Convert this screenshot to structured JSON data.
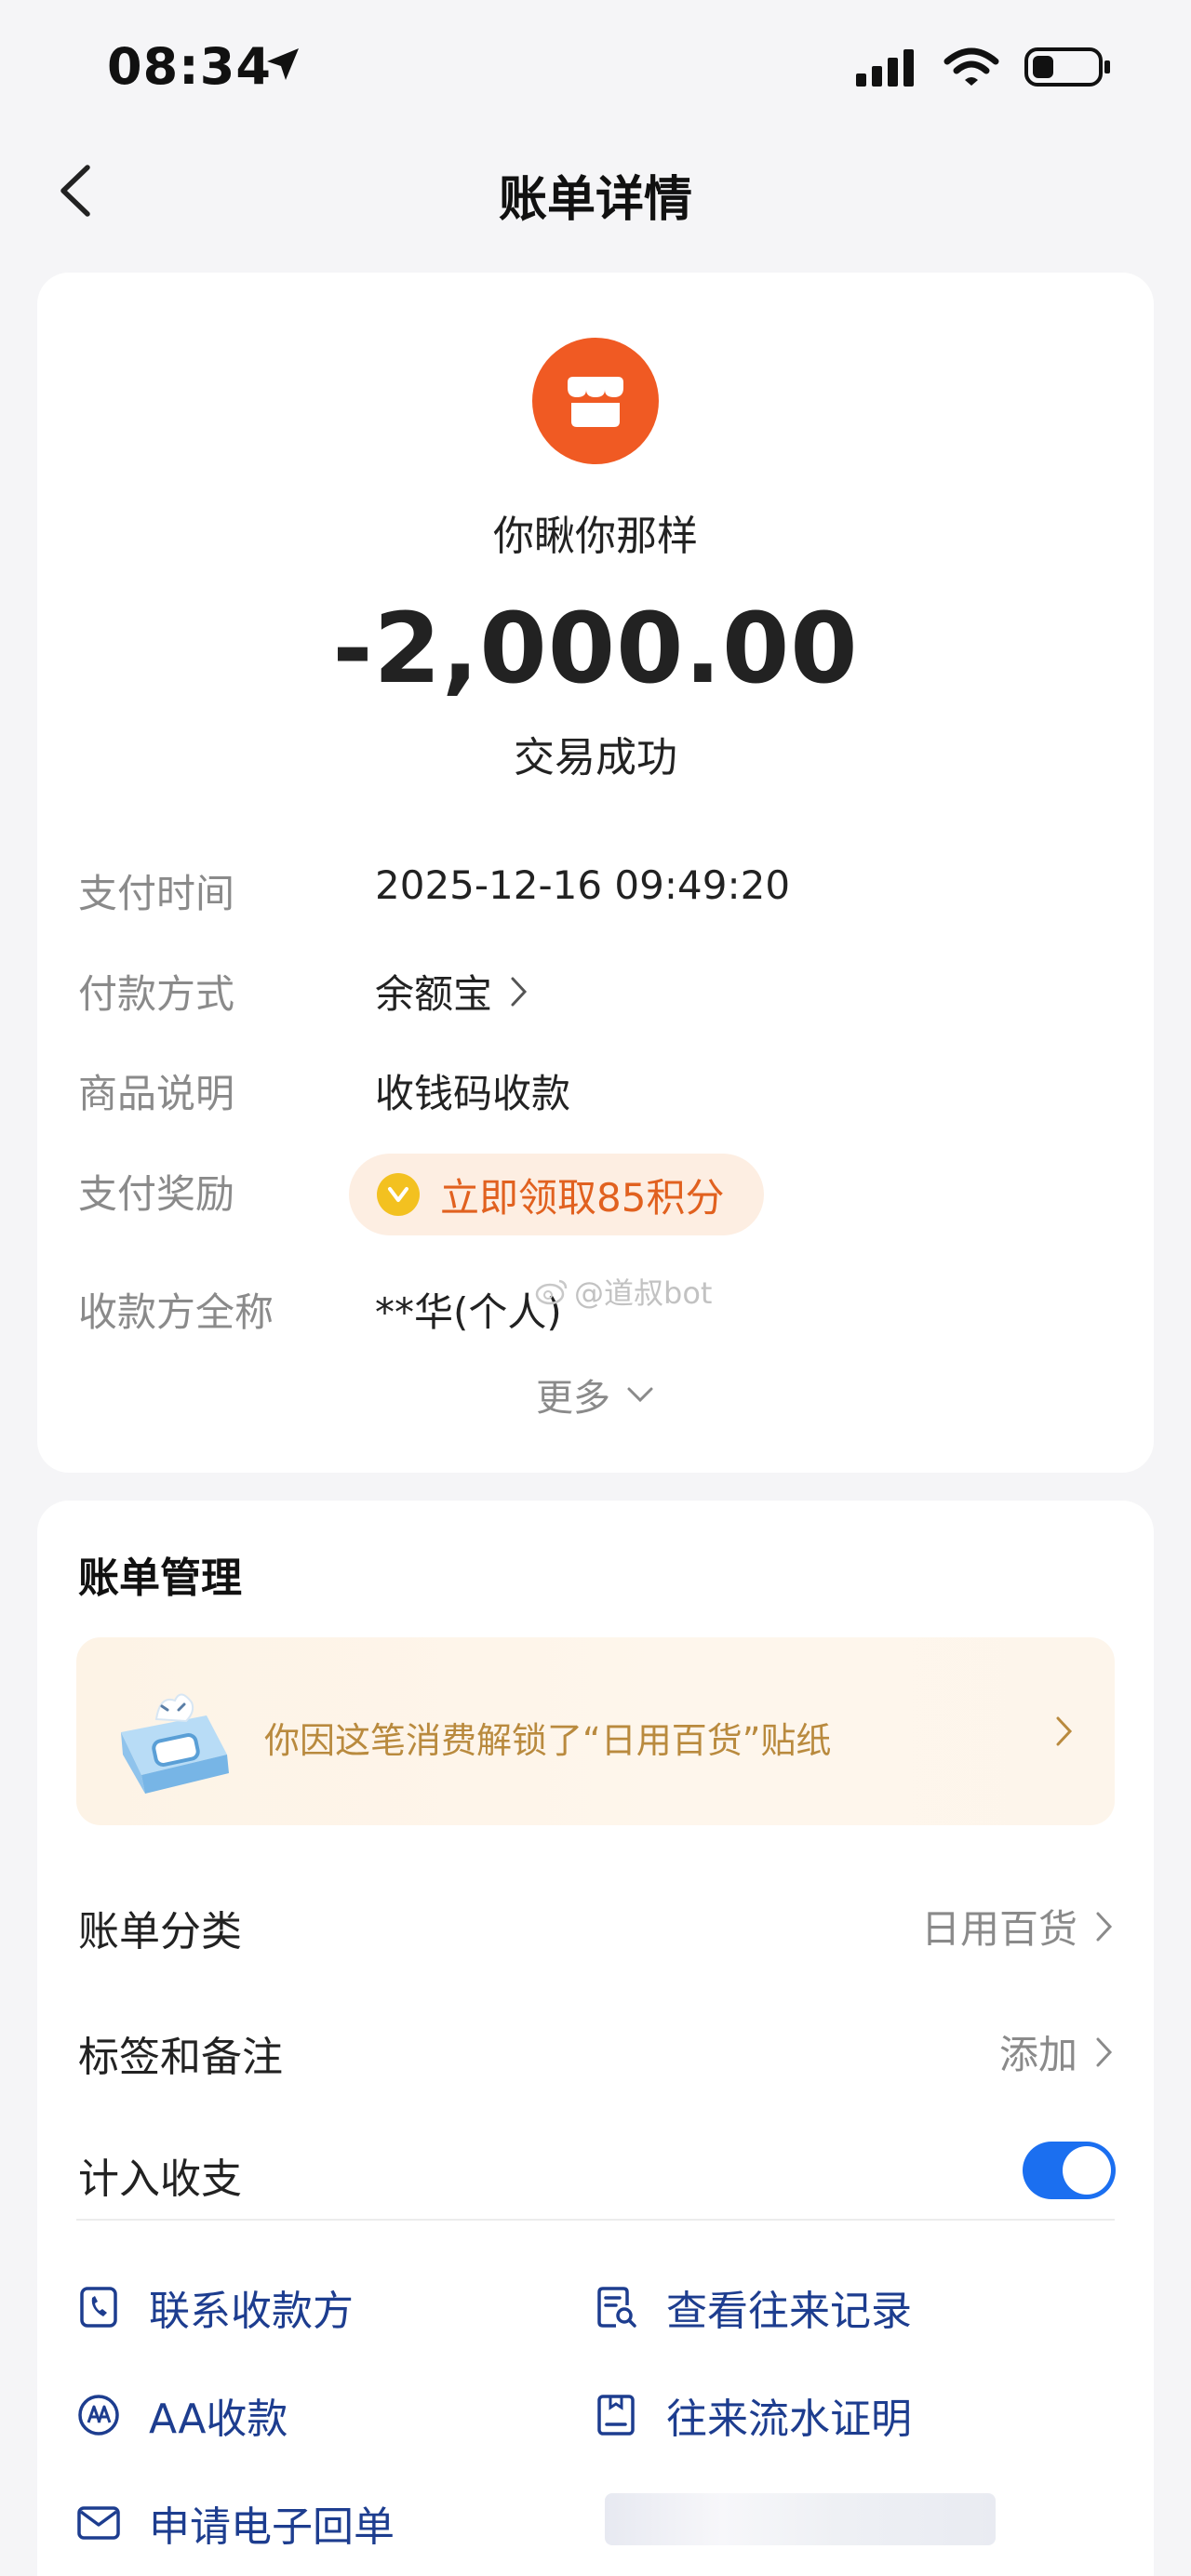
{
  "status_bar": {
    "time": "08:34"
  },
  "nav": {
    "title": "账单详情"
  },
  "detail": {
    "merchant_name": "你瞅你那样",
    "amount": "-2,000.00",
    "status": "交易成功",
    "rows": [
      {
        "label": "支付时间",
        "value": "2025-12-16 09:49:20"
      },
      {
        "label": "付款方式",
        "value": "余额宝"
      },
      {
        "label": "商品说明",
        "value": "收钱码收款"
      },
      {
        "label": "支付奖励",
        "value": "立即领取85积分"
      },
      {
        "label": "收款方全称",
        "value": "**华(个人)"
      }
    ],
    "watermark": "@道叔bot",
    "more_label": "更多"
  },
  "management": {
    "title": "账单管理",
    "banner_text": "你因这笔消费解锁了“日用百货”贴纸",
    "items": [
      {
        "label": "账单分类",
        "value": "日用百货"
      },
      {
        "label": "标签和备注",
        "value": "添加"
      },
      {
        "label": "计入收支",
        "toggle_on": true
      }
    ],
    "actions": [
      {
        "label": "联系收款方",
        "icon": "phone-icon"
      },
      {
        "label": "查看往来记录",
        "icon": "record-search-icon"
      },
      {
        "label": "AA收款",
        "icon": "aa-icon"
      },
      {
        "label": "往来流水证明",
        "icon": "certificate-icon"
      },
      {
        "label": "申请电子回单",
        "icon": "envelope-icon"
      }
    ]
  },
  "colors": {
    "accent_blue": "#1b6ff0",
    "merchant_orange": "#f05a23",
    "reward_orange": "#e1611f",
    "action_text": "#1d3d8f"
  }
}
